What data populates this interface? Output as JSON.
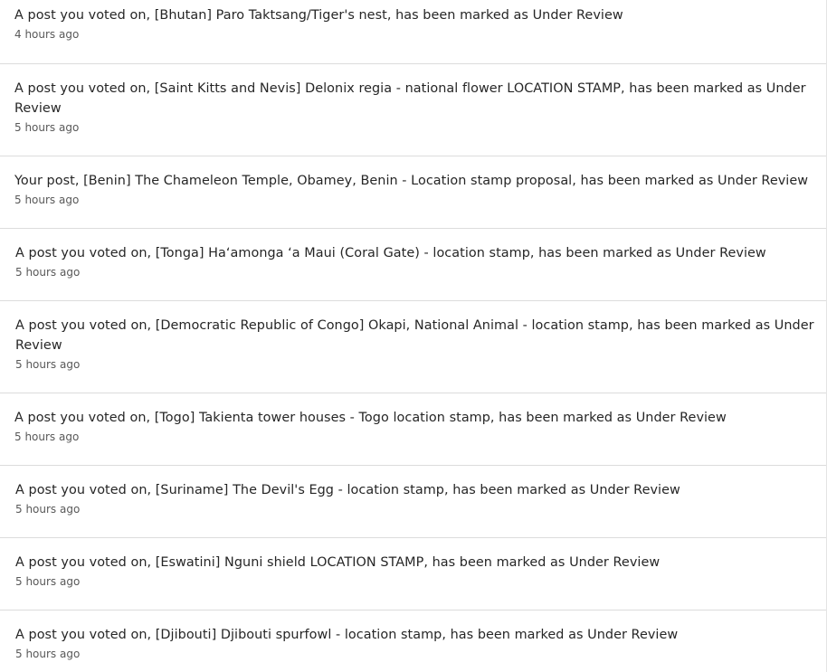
{
  "notifications": [
    {
      "message": "A post you voted on, [Bhutan] Paro Taktsang/Tiger's nest, has been marked as Under Review",
      "time": "4 hours ago"
    },
    {
      "message": "A post you voted on, [Saint Kitts and Nevis] Delonix regia - national flower LOCATION STAMP, has been marked as Under Review",
      "time": "5 hours ago"
    },
    {
      "message": "Your post, [Benin] The Chameleon Temple, Obamey, Benin - Location stamp proposal, has been marked as Under Review",
      "time": "5 hours ago"
    },
    {
      "message": "A post you voted on, [Tonga] Haʻamonga ʻa Maui (Coral Gate) - location stamp, has been marked as Under Review",
      "time": "5 hours ago"
    },
    {
      "message": "A post you voted on, [Democratic Republic of Congo] Okapi, National Animal - location stamp, has been marked as Under Review",
      "time": "5 hours ago"
    },
    {
      "message": "A post you voted on, [Togo] Takienta tower houses - Togo location stamp, has been marked as Under Review",
      "time": "5 hours ago"
    },
    {
      "message": "A post you voted on, [Suriname] The Devil's Egg - location stamp, has been marked as Under Review",
      "time": "5 hours ago"
    },
    {
      "message": "A post you voted on, [Eswatini] Nguni shield LOCATION STAMP, has been marked as Under Review",
      "time": "5 hours ago"
    },
    {
      "message": "A post you voted on, [Djibouti] Djibouti spurfowl - location stamp, has been marked as Under Review",
      "time": "5 hours ago"
    }
  ]
}
